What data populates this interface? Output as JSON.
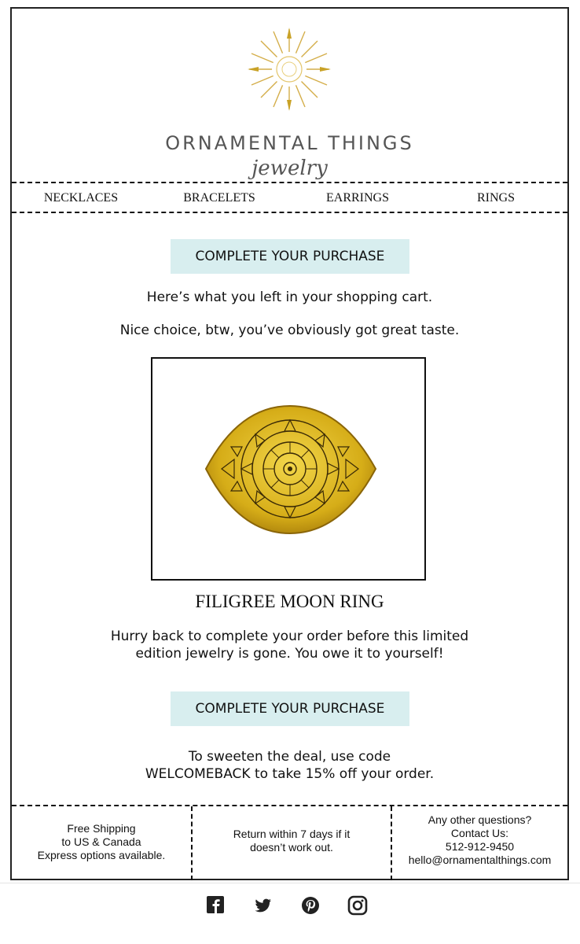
{
  "brand": {
    "name": "ORNAMENTAL THINGS",
    "subtitle": "jewelry"
  },
  "nav": {
    "items": [
      "NECKLACES",
      "BRACELETS",
      "EARRINGS",
      "RINGS"
    ]
  },
  "cta": {
    "label": "COMPLETE YOUR PURCHASE"
  },
  "intro": {
    "line1": "Here’s what you left in your shopping cart.",
    "line2": "Nice choice, btw, you’ve obviously got great taste."
  },
  "product": {
    "name": "FILIGREE MOON RING"
  },
  "hurry": {
    "line1": "Hurry back to complete your order before this limited",
    "line2": "edition jewelry is gone. You owe it to yourself!"
  },
  "promo": {
    "line1": "To sweeten the deal, use code",
    "line2": "WELCOMEBACK to take 15% off your order."
  },
  "footer": {
    "shipping": [
      "Free Shipping",
      "to US & Canada",
      "Express options available."
    ],
    "returns": [
      "Return within 7 days if it",
      "doesn’t work out."
    ],
    "contact": [
      "Any other questions?",
      "Contact Us:",
      "512-912-9450",
      "hello@ornamentalthings.com"
    ]
  },
  "social": [
    "facebook-icon",
    "twitter-icon",
    "pinterest-icon",
    "instagram-icon"
  ],
  "colors": {
    "button_bg": "#d8eeef",
    "gold": "#c9a227",
    "text": "#111111"
  }
}
